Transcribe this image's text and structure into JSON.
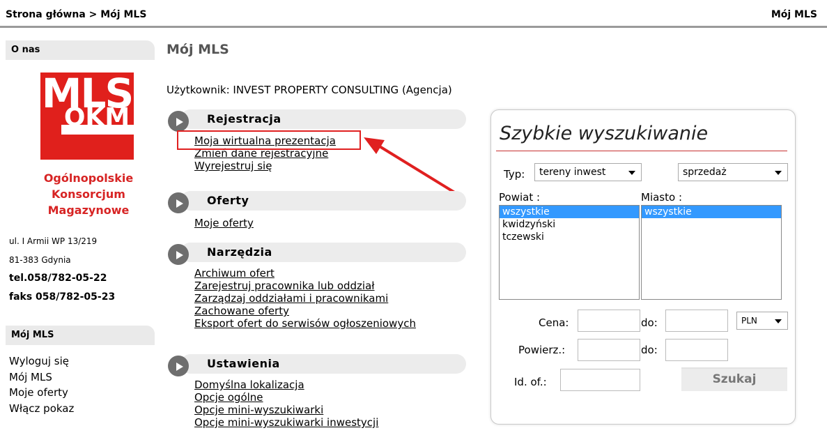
{
  "header": {
    "breadcrumb": "Strona główna > Mój MLS",
    "right_title": "Mój MLS"
  },
  "sidebar": {
    "about_heading": "O nas",
    "logo_text_top": "MLS",
    "logo_text_bottom": "OKM",
    "org_lines": [
      "Ogólnopolskie",
      "Konsorcjum",
      "Magazynowe"
    ],
    "address_line1": "ul. I Armii WP 13/219",
    "address_line2": "81-383 Gdynia",
    "tel": "tel.058/782-05-22",
    "fax": "faks 058/782-05-23",
    "mymls_heading": "Mój MLS",
    "links": [
      "Wyloguj się",
      "Mój MLS",
      "Moje oferty",
      "Włącz pokaz"
    ]
  },
  "main": {
    "title": "Mój MLS",
    "user_line": "Użytkownik: INVEST PROPERTY CONSULTING (Agencja)",
    "sections": [
      {
        "label": "Rejestracja",
        "links": [
          "Moja wirtualna prezentacja",
          "Zmień dane rejestracyjne",
          "Wyrejestruj się"
        ]
      },
      {
        "label": "Oferty",
        "links": [
          "Moje oferty"
        ]
      },
      {
        "label": "Narzędzia",
        "links": [
          "Archiwum ofert",
          "Zarejestruj pracownika lub oddział",
          "Zarządzaj oddziałami i pracownikami",
          "Zachowane oferty",
          "Eksport ofert do serwisów ogłoszeniowych"
        ]
      },
      {
        "label": "Ustawienia",
        "links": [
          "Domyślna lokalizacja",
          "Opcje ogólne",
          "Opcje mini-wyszukiwarki",
          "Opcje mini-wyszukiwarki inwestycji"
        ]
      }
    ]
  },
  "search": {
    "title": "Szybkie wyszukiwanie",
    "type_label": "Typ:",
    "type_value": "tereny inwest",
    "deal_value": "sprzedaż",
    "powiat_label": "Powiat :",
    "powiat_options": [
      "wszystkie",
      "kwidzyński",
      "tczewski"
    ],
    "miasto_label": "Miasto :",
    "miasto_options": [
      "wszystkie"
    ],
    "price_label": "Cena:",
    "to_label": "do:",
    "currency": "PLN",
    "area_label": "Powierz.:",
    "id_label": "Id. of.:",
    "button": "Szukaj"
  },
  "colors": {
    "accent_red": "#e0201c",
    "highlight_blue": "#3399ff"
  }
}
